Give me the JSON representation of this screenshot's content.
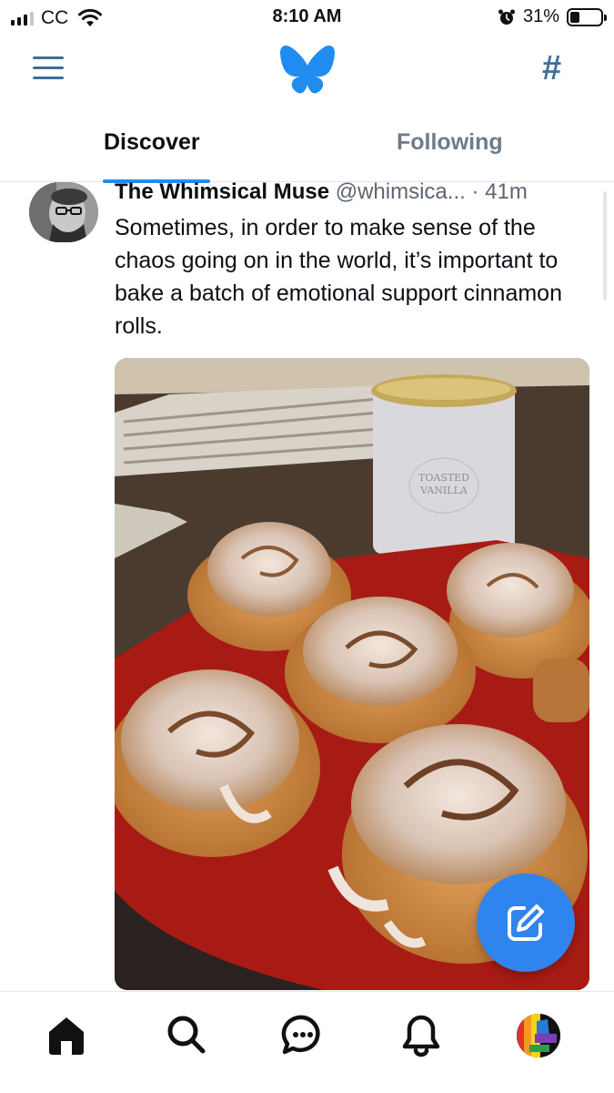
{
  "status_bar": {
    "carrier": "CC",
    "time": "8:10 AM",
    "battery_percent": "31%",
    "battery_level": 0.31,
    "icons": [
      "signal-icon",
      "wifi-icon",
      "alarm-icon",
      "battery-icon"
    ]
  },
  "header": {
    "icons": [
      "menu-icon",
      "butterfly-logo",
      "hashtag-icon"
    ],
    "hash_symbol": "#",
    "accent_color": "#1f8cf0"
  },
  "tabs": [
    {
      "label": "Discover",
      "active": true
    },
    {
      "label": "Following",
      "active": false
    }
  ],
  "post": {
    "author": "The Whimsical Muse",
    "handle": "@whimsica...",
    "separator": "·",
    "time": "41m",
    "text": "Sometimes, in order to make sense of the chaos going on in the world, it’s important to bake a batch of emotional support cinnamon rolls.",
    "image": {
      "description_icon": "photo-icon",
      "candle_label_line1": "TOASTED",
      "candle_label_line2": "VANILLA"
    }
  },
  "fab": {
    "icon": "compose-icon",
    "color": "#2f84ee"
  },
  "bottom_nav": {
    "items": [
      "home-icon",
      "search-icon",
      "chat-icon",
      "bell-icon",
      "profile-avatar"
    ]
  }
}
